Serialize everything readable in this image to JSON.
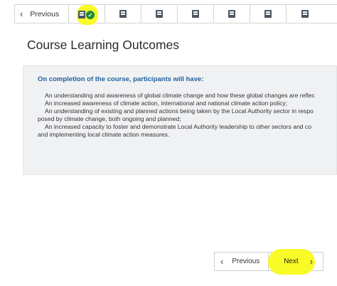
{
  "top_nav": {
    "previous_label": "Previous",
    "steps": [
      {
        "icon": "book-icon",
        "completed": true,
        "check_icon": "check-circle-icon"
      },
      {
        "icon": "book-icon"
      },
      {
        "icon": "book-icon"
      },
      {
        "icon": "book-icon"
      },
      {
        "icon": "book-icon"
      },
      {
        "icon": "book-icon"
      },
      {
        "icon": "book-icon"
      }
    ]
  },
  "main": {
    "title": "Course Learning Outcomes",
    "heading": "On completion of the course, participants will have:",
    "outcomes": [
      "An understanding and awareness of global climate change and how these global changes are reflec",
      "An increased awareness of climate action, international and national climate action policy;",
      "An understanding of existing and planned actions being taken by the Local Authority sector in respo",
      "posed by climate change, both ongoing and planned;",
      "An increased capacity to foster and demonstrate Local Authority leadership to other sectors and co",
      "and implementing local climate action measures."
    ]
  },
  "bottom_nav": {
    "previous_label": "Previous",
    "next_label": "Next"
  },
  "colors": {
    "highlight": "#f9fb27",
    "heading_blue": "#1f5f9e",
    "check_green": "#1f8a3e",
    "panel_bg": "#f0f1f3"
  }
}
